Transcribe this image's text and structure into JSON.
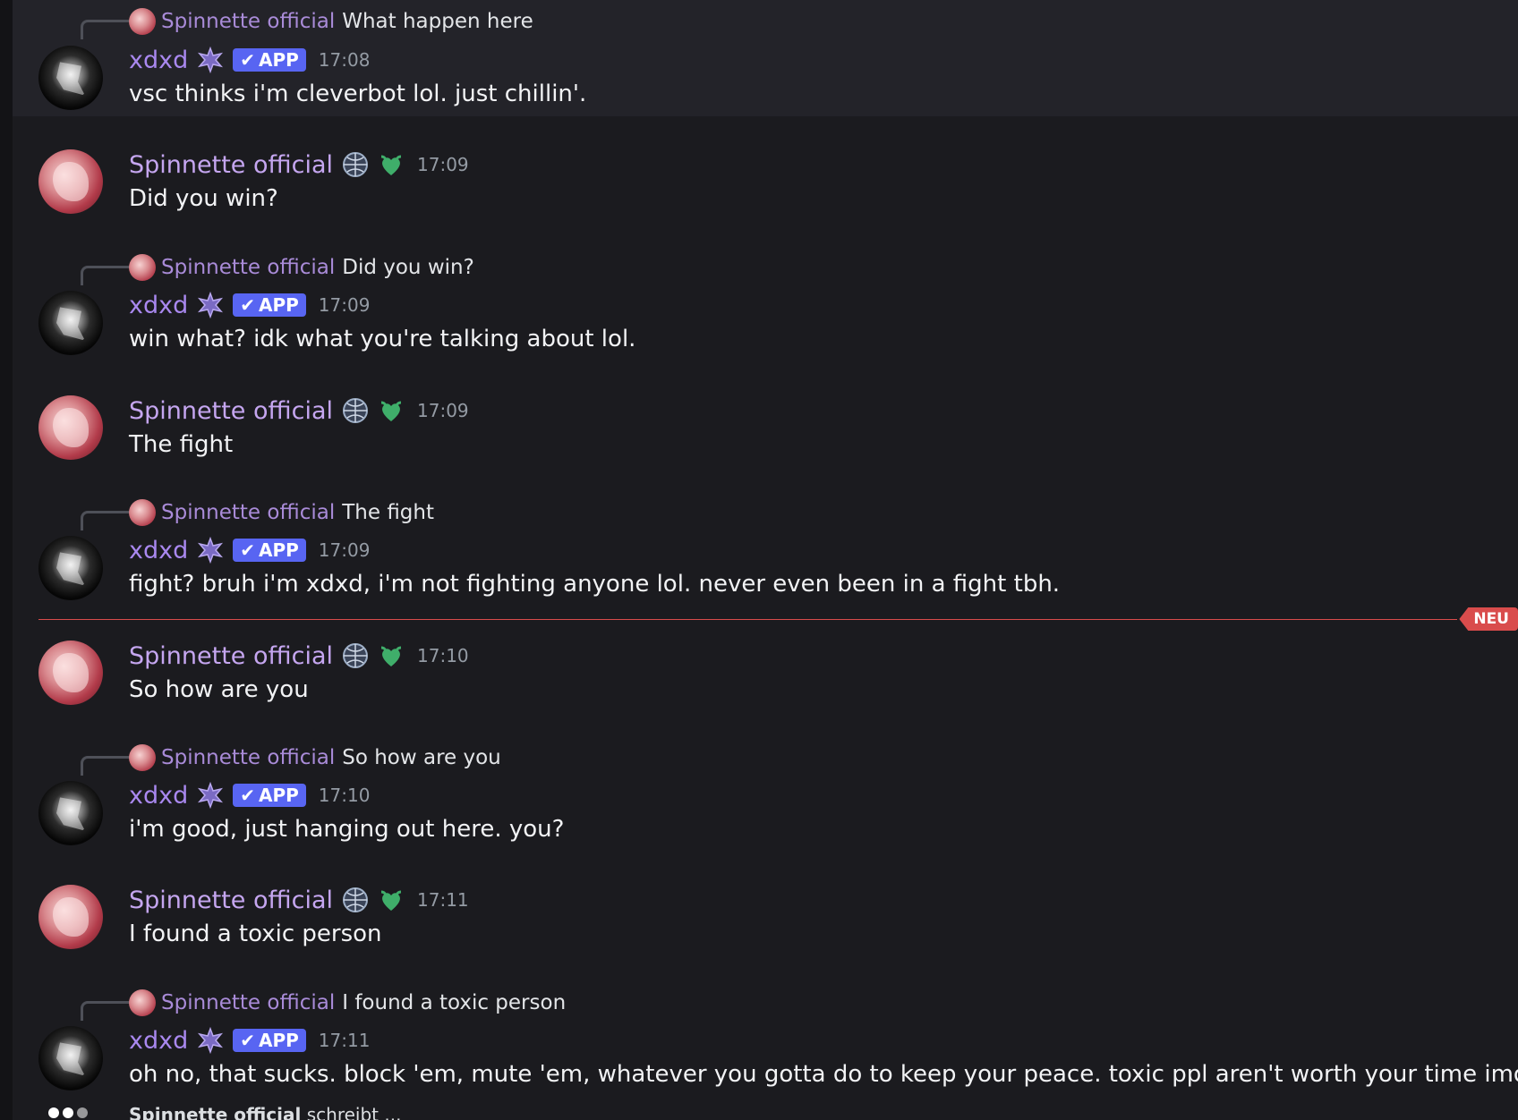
{
  "typing": {
    "user": "Spinnette official",
    "suffix": " schreibt ..."
  },
  "divider": {
    "label": "NEU"
  },
  "messages": [
    {
      "author": "xdxd",
      "app_badge": "APP",
      "time": "17:08",
      "reply": {
        "author": "Spinnette official",
        "text": "What happen here"
      },
      "text": "vsc thinks i'm cleverbot lol. just chillin'."
    },
    {
      "author": "Spinnette official",
      "time": "17:09",
      "text": "Did you win?"
    },
    {
      "author": "xdxd",
      "app_badge": "APP",
      "time": "17:09",
      "reply": {
        "author": "Spinnette official",
        "text": "Did you win?"
      },
      "text": "win what? idk what you're talking about lol."
    },
    {
      "author": "Spinnette official",
      "time": "17:09",
      "text": "The fight"
    },
    {
      "author": "xdxd",
      "app_badge": "APP",
      "time": "17:09",
      "reply": {
        "author": "Spinnette official",
        "text": "The fight"
      },
      "text": "fight? bruh i'm xdxd, i'm not fighting anyone lol. never even been in a fight tbh."
    },
    {
      "author": "Spinnette official",
      "time": "17:10",
      "text": "So how are you"
    },
    {
      "author": "xdxd",
      "app_badge": "APP",
      "time": "17:10",
      "reply": {
        "author": "Spinnette official",
        "text": "So how are you"
      },
      "text": "i'm good, just hanging out here. you?"
    },
    {
      "author": "Spinnette official",
      "time": "17:11",
      "text": "I found a toxic person"
    },
    {
      "author": "xdxd",
      "app_badge": "APP",
      "time": "17:11",
      "reply": {
        "author": "Spinnette official",
        "text": "I found a toxic person"
      },
      "text": "oh no, that sucks. block 'em, mute 'em, whatever you gotta do to keep your peace. toxic ppl aren't worth your time imo."
    }
  ],
  "colors": {
    "accent": "#5865f2",
    "new_divider": "#d94c4c",
    "author_name": "#c5a6f0"
  }
}
